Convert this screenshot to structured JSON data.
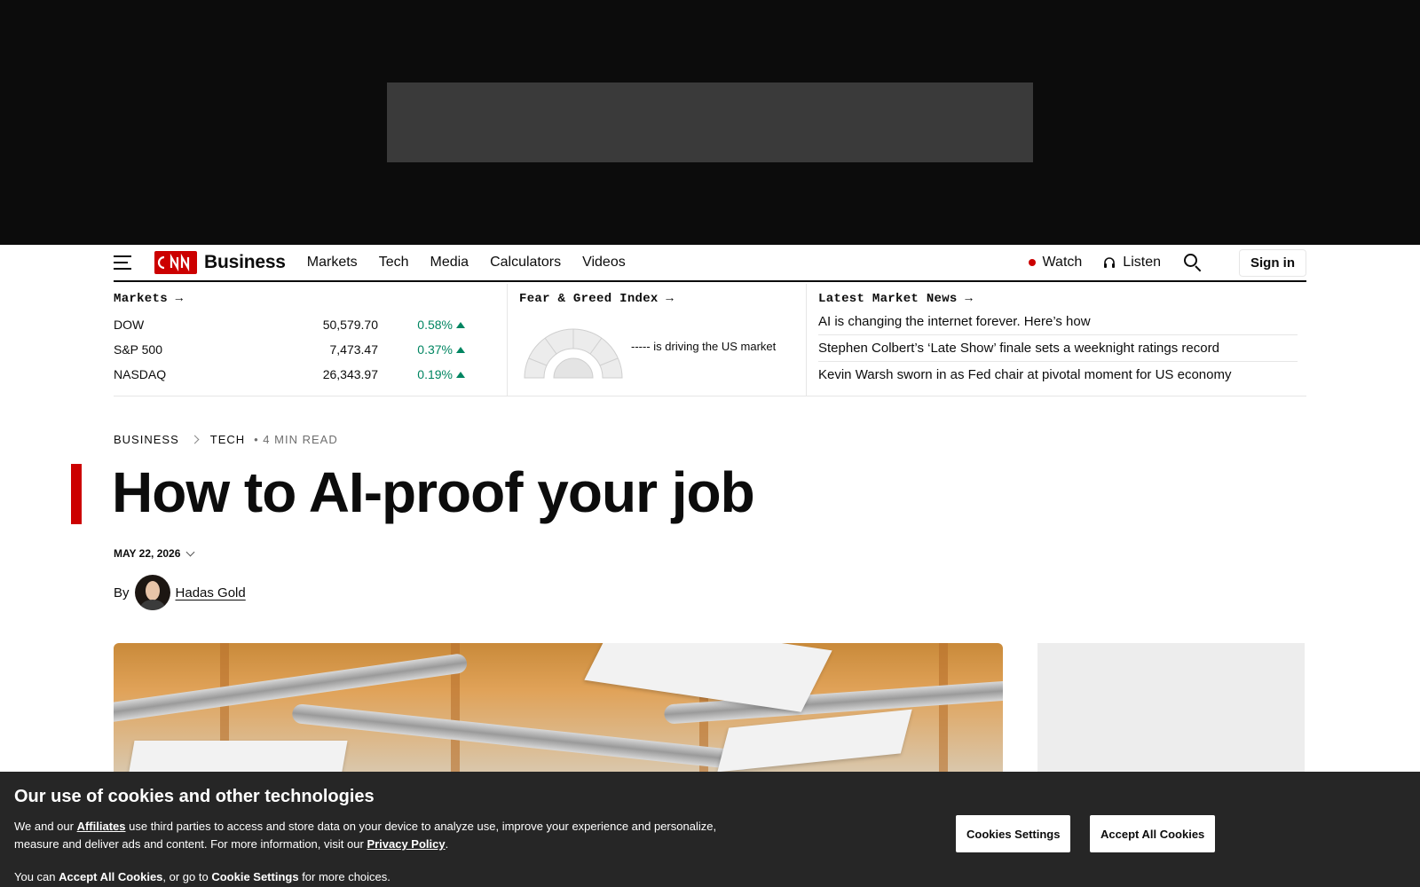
{
  "nav": {
    "brand": "Business",
    "links": [
      "Markets",
      "Tech",
      "Media",
      "Calculators",
      "Videos"
    ],
    "watch": "Watch",
    "listen": "Listen",
    "signin": "Sign in"
  },
  "markets": {
    "heading": "Markets",
    "indices": [
      {
        "name": "DOW",
        "value": "50,579.70",
        "change": "0.58%",
        "direction": "up"
      },
      {
        "name": "S&P 500",
        "value": "7,473.47",
        "change": "0.37%",
        "direction": "up"
      },
      {
        "name": "NASDAQ",
        "value": "26,343.97",
        "change": "0.19%",
        "direction": "up"
      }
    ],
    "fear_greed": {
      "heading": "Fear & Greed Index",
      "text": "----- is driving the US market"
    },
    "news": {
      "heading": "Latest Market News",
      "items": [
        "AI is changing the internet forever. Here’s how",
        "Stephen Colbert’s ‘Late Show’ finale sets a weeknight ratings record",
        "Kevin Warsh sworn in as Fed chair at pivotal moment for US economy"
      ]
    }
  },
  "article": {
    "breadcrumb": [
      "Business",
      "Tech"
    ],
    "read_time": "• 4 min read",
    "headline": "How to AI-proof your job",
    "date": "MAY 22, 2026",
    "by": "By",
    "author": "Hadas Gold"
  },
  "cookie": {
    "title": "Our use of cookies and other technologies",
    "body_prefix": "We and our",
    "affiliates": "Affiliates",
    "body_mid": "use third parties to access and store data on your device to analyze use, improve your experience and personalize, measure and deliver ads and content. For more information, visit our",
    "privacy": "Privacy Policy",
    "body_end": ".",
    "foot_1": "You can ",
    "foot_accept": "Accept All Cookies",
    "foot_2": ", or go to ",
    "foot_settings": "Cookie Settings",
    "foot_3": " for more choices.",
    "settings_button": "Cookies Settings",
    "accept_button": "Accept All Cookies"
  },
  "colors": {
    "accent": "#cc0000",
    "positive": "#008561",
    "banner": "#262626"
  }
}
